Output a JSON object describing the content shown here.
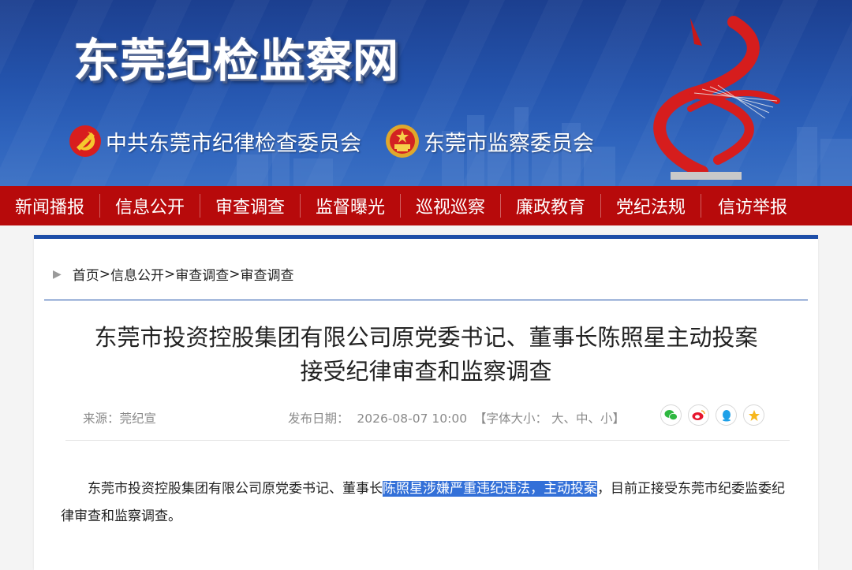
{
  "site": {
    "title": "东莞纪检监察网",
    "org_commission": "中共东莞市纪律检查委员会",
    "org_supervision": "东莞市监察委员会"
  },
  "nav": [
    "新闻播报",
    "信息公开",
    "审查调查",
    "监督曝光",
    "巡视巡察",
    "廉政教育",
    "党纪法规",
    "信访举报"
  ],
  "breadcrumb": {
    "home": "首页",
    "sep": ">",
    "level1": "信息公开",
    "level2": "审查调查",
    "level3": "审查调查"
  },
  "article": {
    "title_line1": "东莞市投资控股集团有限公司原党委书记、董事长陈照星主动投案",
    "title_line2": "接受纪律审查和监察调查",
    "source": "来源：莞纪宣",
    "date_label": "发布日期：",
    "date": "2026-08-07 10:00",
    "font_size_label": "【字体大小：",
    "font_large": "大",
    "font_medium": "中",
    "font_small": "小",
    "font_sep": "、",
    "font_close": "】",
    "body_before": "东莞市投资控股集团有限公司原党委书记、董事长",
    "body_highlight": "陈照星涉嫌严重违纪违法，主动投案",
    "body_after": "，目前正接受东莞市纪委监委纪律审查和监察调查。"
  },
  "share": [
    "wechat-icon",
    "weibo-icon",
    "qq-icon",
    "qzone-icon"
  ],
  "colors": {
    "banner_blue": "#2454ad",
    "nav_red": "#b70a0b",
    "accent_blue": "#1d4ea8",
    "highlight": "#3370d8"
  }
}
